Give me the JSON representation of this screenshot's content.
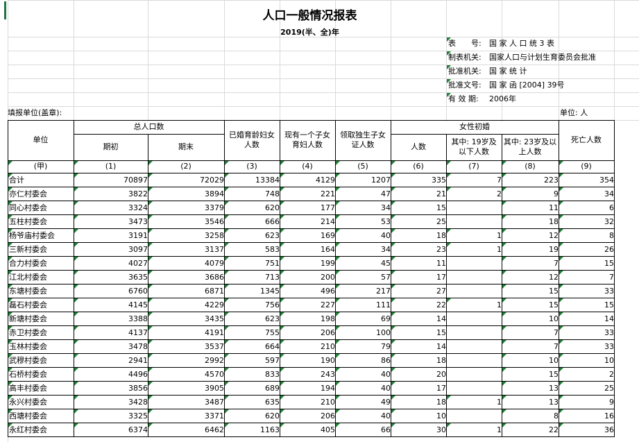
{
  "report": {
    "title": "人口一般情况报表",
    "subtitle": "2019(半、全)年"
  },
  "meta": [
    {
      "label": "表　　号:",
      "value": "国 家 人 口 统 3 表"
    },
    {
      "label": "制表机关:",
      "value": "国家人口与计划生育委员会批准"
    },
    {
      "label": "批准机关:",
      "value": "国 家 统 计"
    },
    {
      "label": "批准文号:",
      "value": "国 家 函 [2004] 39号"
    },
    {
      "label": "有 效 期:",
      "value": "2006年"
    }
  ],
  "fill_unit_label": "填报单位(盖章):",
  "unit_label": "单位: 人",
  "headers": {
    "unit": "单位",
    "total_population": "总人口数",
    "start": "期初",
    "end": "期末",
    "married_women": "已婚育龄妇女人数",
    "one_child_women": "现有一个子女育妇人数",
    "only_child_cert": "领取独生子女证人数",
    "female_first_marriage": "女性初婚",
    "count": "人数",
    "under19": "其中: 19岁及以下人数",
    "over23": "其中: 23岁及以上人数",
    "deaths": "死亡人数"
  },
  "codes": [
    "(甲)",
    "(1)",
    "(2)",
    "(3)",
    "(4)",
    "(5)",
    "(6)",
    "(7)",
    "(8)",
    "(9)"
  ],
  "rows": [
    {
      "name": "合计",
      "v": [
        "70897",
        "72029",
        "13384",
        "4129",
        "1207",
        "335",
        "7",
        "223",
        "354"
      ]
    },
    {
      "name": "亦仁村委会",
      "v": [
        "3822",
        "3894",
        "748",
        "221",
        "47",
        "21",
        "2",
        "9",
        "34"
      ]
    },
    {
      "name": "同心村委会",
      "v": [
        "3324",
        "3379",
        "620",
        "177",
        "34",
        "15",
        "",
        "11",
        "6"
      ]
    },
    {
      "name": "五柱村委会",
      "v": [
        "3473",
        "3546",
        "666",
        "214",
        "53",
        "25",
        "",
        "18",
        "32"
      ]
    },
    {
      "name": "杨爷庙村委会",
      "v": [
        "3191",
        "3258",
        "623",
        "169",
        "40",
        "18",
        "1",
        "12",
        "8"
      ]
    },
    {
      "name": "三新村委会",
      "v": [
        "3097",
        "3137",
        "583",
        "164",
        "34",
        "23",
        "1",
        "19",
        "26"
      ]
    },
    {
      "name": "合力村委会",
      "v": [
        "4027",
        "4079",
        "751",
        "199",
        "45",
        "11",
        "",
        "7",
        "15"
      ]
    },
    {
      "name": "江北村委会",
      "v": [
        "3635",
        "3686",
        "713",
        "200",
        "57",
        "17",
        "",
        "12",
        "7"
      ]
    },
    {
      "name": "东塘村委会",
      "v": [
        "6760",
        "6871",
        "1345",
        "496",
        "217",
        "27",
        "",
        "15",
        "33"
      ]
    },
    {
      "name": "磊石村委会",
      "v": [
        "4145",
        "4229",
        "756",
        "227",
        "111",
        "22",
        "1",
        "15",
        "15"
      ]
    },
    {
      "name": "新塘村委会",
      "v": [
        "3388",
        "3435",
        "623",
        "198",
        "69",
        "14",
        "",
        "10",
        "14"
      ]
    },
    {
      "name": "赤卫村委会",
      "v": [
        "4137",
        "4191",
        "755",
        "206",
        "100",
        "15",
        "",
        "7",
        "33"
      ]
    },
    {
      "name": "玉林村委会",
      "v": [
        "3478",
        "3537",
        "664",
        "210",
        "79",
        "14",
        "",
        "7",
        "33"
      ]
    },
    {
      "name": "武穆村委会",
      "v": [
        "2941",
        "2992",
        "597",
        "190",
        "86",
        "18",
        "",
        "10",
        "10"
      ]
    },
    {
      "name": "石桥村委会",
      "v": [
        "4496",
        "4570",
        "833",
        "243",
        "40",
        "20",
        "",
        "15",
        "2"
      ]
    },
    {
      "name": "高丰村委会",
      "v": [
        "3856",
        "3905",
        "689",
        "194",
        "40",
        "17",
        "",
        "13",
        "25"
      ]
    },
    {
      "name": "永兴村委会",
      "v": [
        "3428",
        "3487",
        "635",
        "210",
        "49",
        "18",
        "1",
        "13",
        "9"
      ]
    },
    {
      "name": "西塘村委会",
      "v": [
        "3325",
        "3371",
        "620",
        "206",
        "40",
        "10",
        "",
        "8",
        "16"
      ]
    },
    {
      "name": "永红村委会",
      "v": [
        "6374",
        "6462",
        "1163",
        "405",
        "66",
        "30",
        "1",
        "22",
        "36"
      ]
    }
  ]
}
